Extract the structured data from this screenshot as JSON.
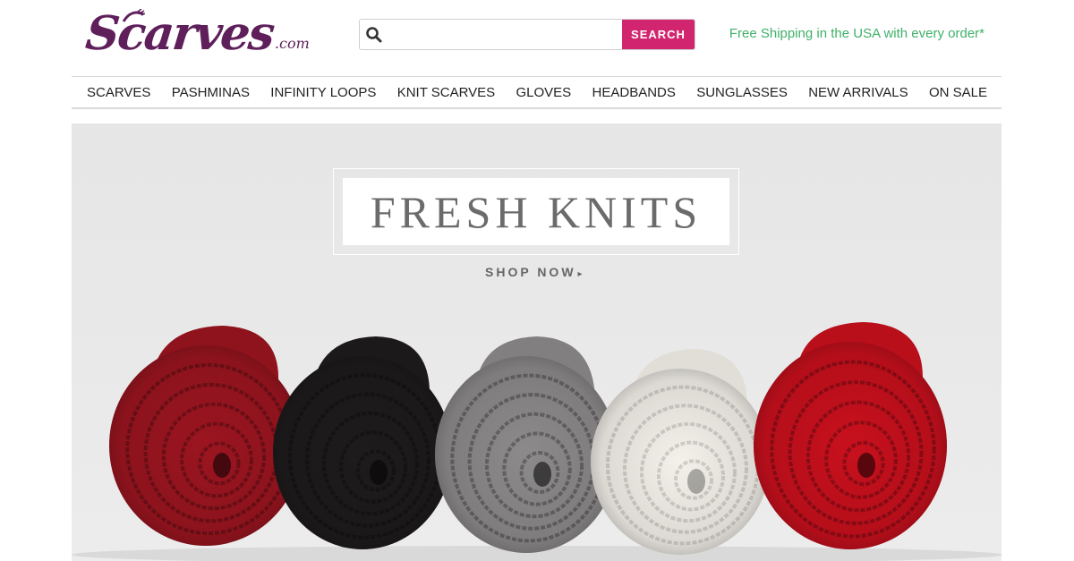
{
  "logo": {
    "word": "Scarves",
    "tld": ".com"
  },
  "search": {
    "placeholder": "",
    "button_label": "SEARCH"
  },
  "shipping_text": "Free Shipping in the USA with every order*",
  "nav": {
    "items": [
      {
        "label": "SCARVES"
      },
      {
        "label": "PASHMINAS"
      },
      {
        "label": "INFINITY LOOPS"
      },
      {
        "label": "KNIT SCARVES"
      },
      {
        "label": "GLOVES"
      },
      {
        "label": "HEADBANDS"
      },
      {
        "label": "SUNGLASSES"
      },
      {
        "label": "NEW ARRIVALS"
      },
      {
        "label": "ON SALE"
      }
    ]
  },
  "hero": {
    "title": "FRESH KNITS",
    "cta_label": "SHOP NOW",
    "cta_icon": "triangle-right-icon",
    "scarf_colors": [
      "#9b1520",
      "#1e1b1c",
      "#8d8a8c",
      "#f4f1ea",
      "#c8101d"
    ]
  },
  "colors": {
    "brand": "#5e1f5a",
    "accent": "#d1266f",
    "shipping": "#3fb068"
  }
}
